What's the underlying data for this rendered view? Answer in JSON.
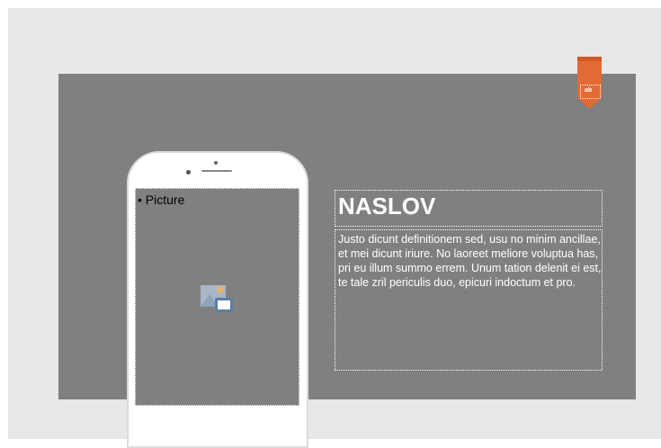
{
  "slide": {
    "title": "NASLOV",
    "body": "Justo dicunt definitionem sed, usu no minim ancillae, et mei dicunt iriure. No laoreet meliore voluptua has, pri eu illum summo errem. Unum tation delenit ei est, te tale zril periculis duo, epicuri indoctum et pro.",
    "picture_placeholder_label": "• Picture",
    "picture_icon": "insert-picture-icon",
    "bookmark_icon": "bookmark-ribbon-icon",
    "bookmark_glyph": "ab"
  },
  "colors": {
    "canvas": "#e8e8e8",
    "slide_background": "#808080",
    "bookmark": "#e26a35",
    "text": "#ffffff"
  }
}
